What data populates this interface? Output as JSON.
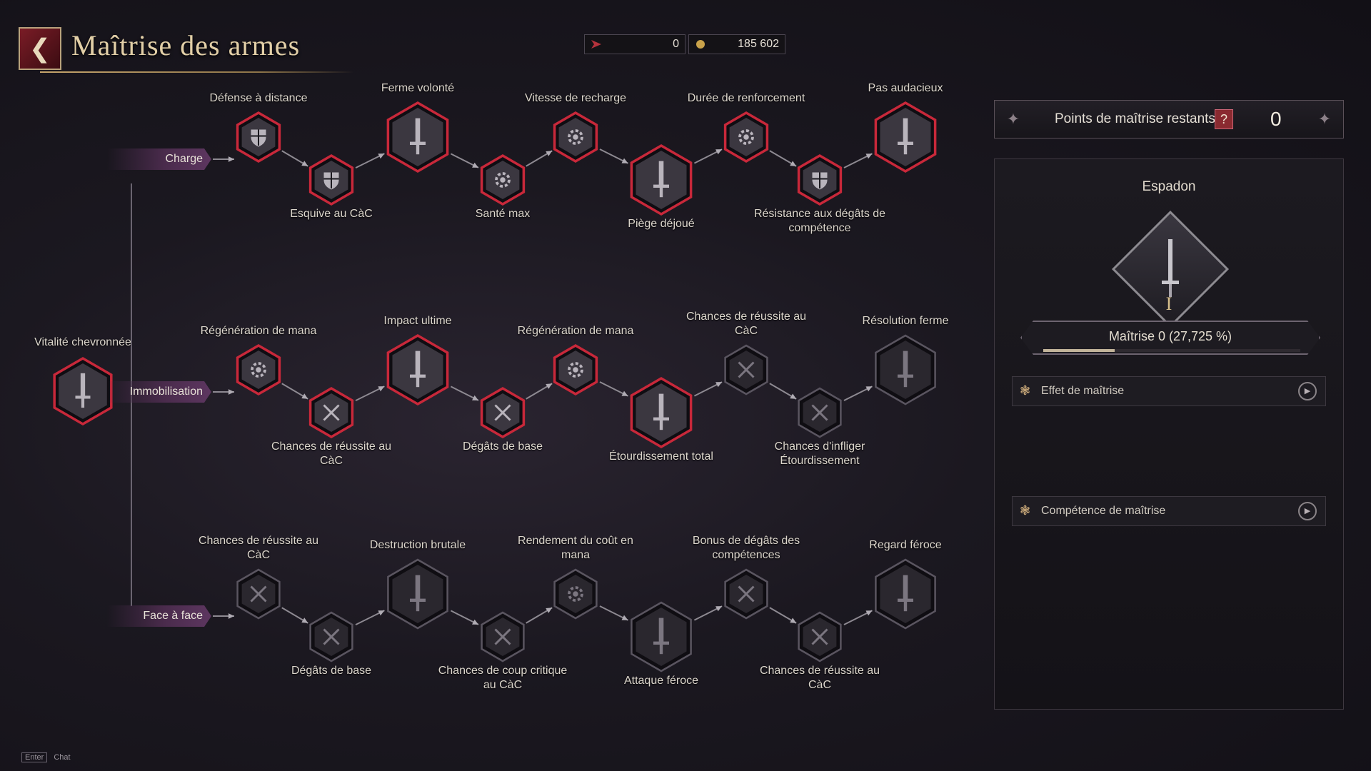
{
  "header": {
    "back_icon": "back-arrow-icon",
    "title": "Maîtrise des armes"
  },
  "currencies": [
    {
      "icon": "arrow-token-icon",
      "value": "0",
      "color": "#b5323c"
    },
    {
      "icon": "gold-coin-icon",
      "value": "185 602",
      "color": "#c9a24a"
    }
  ],
  "tree": {
    "root": {
      "label": "Vitalité chevronnée",
      "state": "active"
    },
    "branches": [
      {
        "name": "Charge",
        "nodes": [
          {
            "label": "Défense à distance",
            "icon": "shield-icon",
            "state": "active",
            "big": false
          },
          {
            "label": "Esquive au CàC",
            "icon": "shield-icon",
            "state": "active",
            "big": false
          },
          {
            "label": "Ferme volonté",
            "icon": "sword-icon",
            "state": "active",
            "big": true
          },
          {
            "label": "Santé max",
            "icon": "gear-icon",
            "state": "active",
            "big": false
          },
          {
            "label": "Vitesse de recharge",
            "icon": "gear-icon",
            "state": "active",
            "big": false
          },
          {
            "label": "Piège déjoué",
            "icon": "sword-icon",
            "state": "active",
            "big": true
          },
          {
            "label": "Durée de renforcement",
            "icon": "gear-icon",
            "state": "active",
            "big": false
          },
          {
            "label": "Résistance aux dégâts de compétence",
            "icon": "shield-icon",
            "state": "active",
            "big": false
          },
          {
            "label": "Pas audacieux",
            "icon": "sword-icon",
            "state": "active",
            "big": true
          }
        ]
      },
      {
        "name": "Immobilisation",
        "nodes": [
          {
            "label": "Régénération de mana",
            "icon": "gear-icon",
            "state": "active",
            "big": false
          },
          {
            "label": "Chances de réussite au CàC",
            "icon": "crossed-swords-icon",
            "state": "active",
            "big": false
          },
          {
            "label": "Impact ultime",
            "icon": "sword-icon",
            "state": "active",
            "big": true
          },
          {
            "label": "Dégâts de base",
            "icon": "crossed-swords-icon",
            "state": "active",
            "big": false
          },
          {
            "label": "Régénération de mana",
            "icon": "gear-icon",
            "state": "active",
            "big": false
          },
          {
            "label": "Étourdissement total",
            "icon": "sword-icon",
            "state": "active",
            "big": true
          },
          {
            "label": "Chances de réussite au CàC",
            "icon": "crossed-swords-icon",
            "state": "locked",
            "big": false
          },
          {
            "label": "Chances d'infliger Étourdissement",
            "icon": "crossed-swords-icon",
            "state": "locked",
            "big": false
          },
          {
            "label": "Résolution ferme",
            "icon": "sword-icon",
            "state": "locked",
            "big": true
          }
        ]
      },
      {
        "name": "Face à face",
        "nodes": [
          {
            "label": "Chances de réussite au CàC",
            "icon": "crossed-swords-icon",
            "state": "locked",
            "big": false
          },
          {
            "label": "Dégâts de base",
            "icon": "crossed-swords-icon",
            "state": "locked",
            "big": false
          },
          {
            "label": "Destruction brutale",
            "icon": "sword-icon",
            "state": "locked",
            "big": true
          },
          {
            "label": "Chances de coup critique au CàC",
            "icon": "crossed-swords-icon",
            "state": "locked",
            "big": false
          },
          {
            "label": "Rendement du coût en mana",
            "icon": "gear-icon",
            "state": "locked",
            "big": false
          },
          {
            "label": "Attaque féroce",
            "icon": "sword-icon",
            "state": "locked",
            "big": true
          },
          {
            "label": "Bonus de dégâts des compétences",
            "icon": "crossed-swords-icon",
            "state": "locked",
            "big": false
          },
          {
            "label": "Chances de réussite au CàC",
            "icon": "crossed-swords-icon",
            "state": "locked",
            "big": false
          },
          {
            "label": "Regard féroce",
            "icon": "sword-icon",
            "state": "locked",
            "big": true
          }
        ]
      }
    ]
  },
  "panel": {
    "points_label": "Points de maîtrise restants",
    "points_help": "?",
    "points_value": "0",
    "weapon_name": "Espadon",
    "rank": "I",
    "mastery_label": "Maîtrise 0",
    "mastery_percent_text": "(27,725 %)",
    "mastery_progress": 0.27725,
    "sections": [
      {
        "label": "Effet de maîtrise",
        "icon": "fleur-icon"
      },
      {
        "label": "Compétence de maîtrise",
        "icon": "fleur-icon"
      }
    ]
  },
  "footer": {
    "key": "Enter",
    "label": "Chat"
  },
  "colors": {
    "active_border": "#c8283a",
    "locked_border": "#5a5560",
    "accent": "#e2cfa7"
  }
}
